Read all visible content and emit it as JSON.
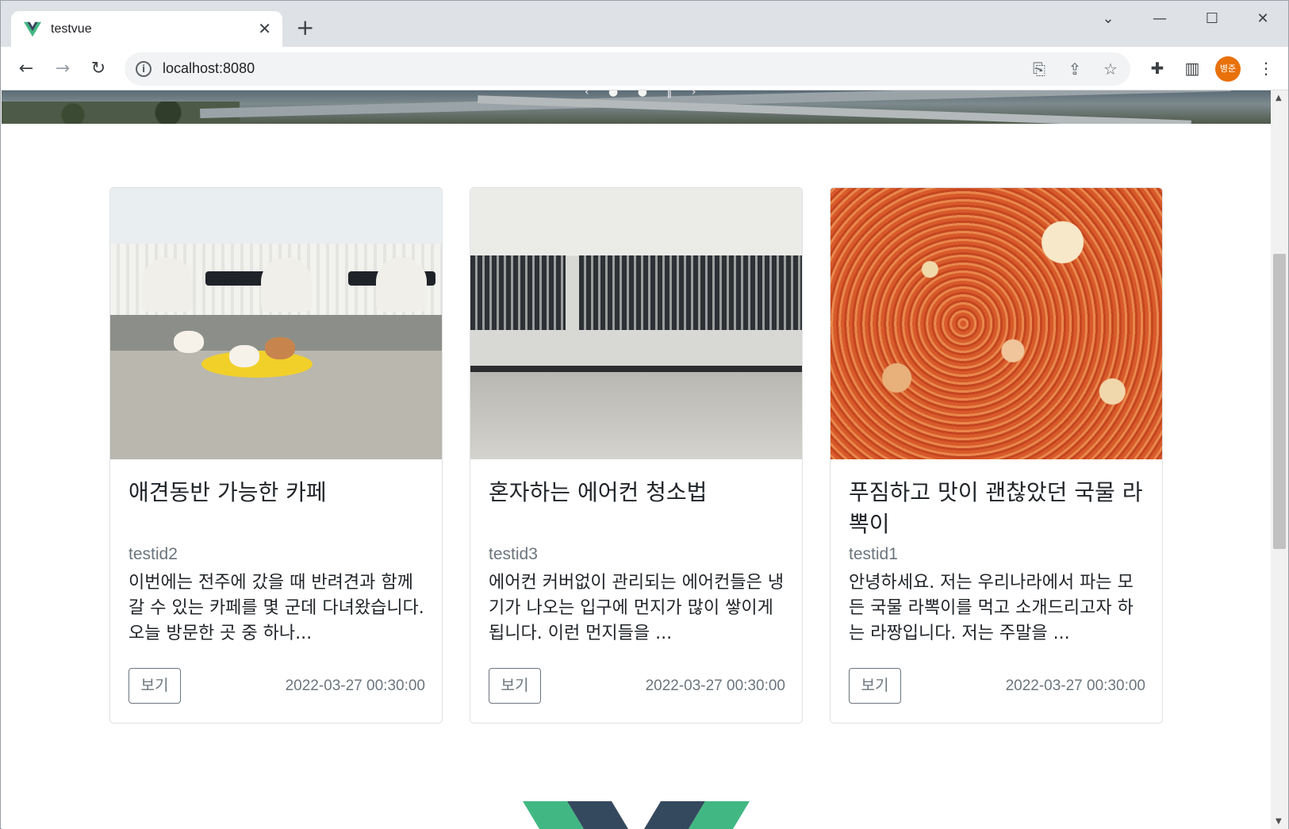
{
  "browser": {
    "tab_title": "testvue",
    "url": "localhost:8080",
    "profile_label": "병준",
    "new_tab_symbol": "+",
    "close_symbol": "✕"
  },
  "hero": {
    "carousel_dots": "‹ ● ● ‖ ›"
  },
  "cards": [
    {
      "title": "애견동반 가능한 카페",
      "author": "testid2",
      "text": "이번에는 전주에 갔을 때 반려견과 함께 갈 수 있는 카페를 몇 군데 다녀왔습니다. 오늘 방문한 곳 중 하나...",
      "button": "보기",
      "date": "2022-03-27 00:30:00",
      "image": "cafe-with-dogs"
    },
    {
      "title": "혼자하는 에어컨 청소법",
      "author": "testid3",
      "text": "에어컨 커버없이 관리되는 에어컨들은 냉기가 나오는 입구에 먼지가 많이 쌓이게 됩니다. 이런 먼지들을 ...",
      "button": "보기",
      "date": "2022-03-27 00:30:00",
      "image": "air-conditioner"
    },
    {
      "title": "푸짐하고 맛이 괜찮았던 국물 라뽁이",
      "author": "testid1",
      "text": "안녕하세요. 저는 우리나라에서 파는 모든 국물 라뽁이를 먹고 소개드리고자 하는 라짱입니다. 저는 주말을 ...",
      "button": "보기",
      "date": "2022-03-27 00:30:00",
      "image": "rabokki"
    }
  ],
  "colors": {
    "vue_green": "#41b883",
    "vue_dark": "#35495e",
    "profile_orange": "#e8710a"
  }
}
